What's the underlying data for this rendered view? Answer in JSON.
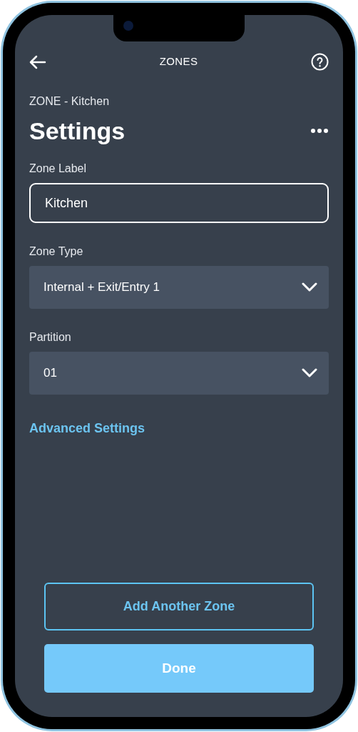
{
  "header": {
    "title": "ZONES"
  },
  "subtitle": "ZONE - Kitchen",
  "title": "Settings",
  "fields": [
    {
      "kind": "input",
      "label": "Zone Label",
      "value": "Kitchen"
    },
    {
      "kind": "select",
      "label": "Zone Type",
      "value": "Internal + Exit/Entry 1"
    },
    {
      "kind": "select",
      "label": "Partition",
      "value": "01"
    }
  ],
  "link": "Advanced Settings",
  "buttons": [
    {
      "kind": "outline",
      "label": "Add Another Zone"
    },
    {
      "kind": "filled",
      "label": "Done"
    }
  ]
}
